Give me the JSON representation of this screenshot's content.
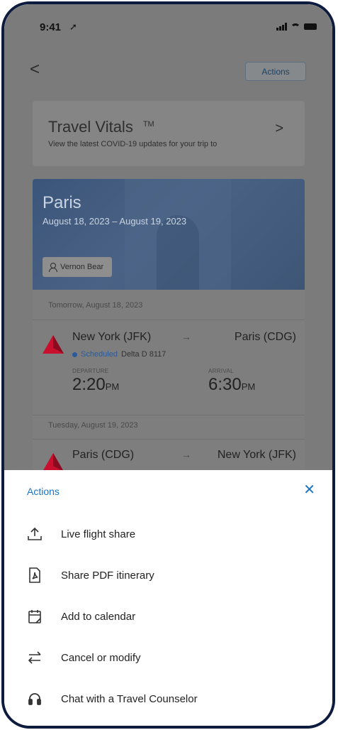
{
  "status_bar": {
    "time": "9:41",
    "location_glyph": "➚"
  },
  "nav": {
    "back_glyph": "<",
    "actions_button": "Actions"
  },
  "vitals": {
    "title": "Travel Vitals",
    "trademark": "TM",
    "subtitle": "View the latest COVID-19 updates for your trip to",
    "chevron": ">"
  },
  "trip": {
    "city": "Paris",
    "dates": "August 18, 2023 – August 19, 2023",
    "traveler": "Vernon Bear",
    "segments": [
      {
        "day": "Tomorrow, August 18, 2023",
        "from": "New York (JFK)",
        "to": "Paris (CDG)",
        "status": "Scheduled",
        "flight": "Delta D 8117",
        "departure_label": "DEPARTURE",
        "departure_time": "2:20",
        "departure_ampm": "PM",
        "arrival_label": "ARRIVAL",
        "arrival_time": "6:30",
        "arrival_ampm": "PM"
      },
      {
        "day": "Tuesday, August 19, 2023",
        "from": "Paris (CDG)",
        "to": "New York (JFK)"
      }
    ],
    "arrow": "→"
  },
  "sheet": {
    "title": "Actions",
    "close_glyph": "✕",
    "items": [
      {
        "label": "Live flight share",
        "icon": "upload-share-icon"
      },
      {
        "label": "Share PDF itinerary",
        "icon": "pdf-file-icon"
      },
      {
        "label": "Add to calendar",
        "icon": "calendar-icon"
      },
      {
        "label": "Cancel or modify",
        "icon": "swap-arrows-icon"
      },
      {
        "label": "Chat with a Travel Counselor",
        "icon": "headset-icon"
      }
    ]
  },
  "colors": {
    "accent": "#1a74c4",
    "delta_red": "#c8102e",
    "frame": "#0d1b3e"
  }
}
